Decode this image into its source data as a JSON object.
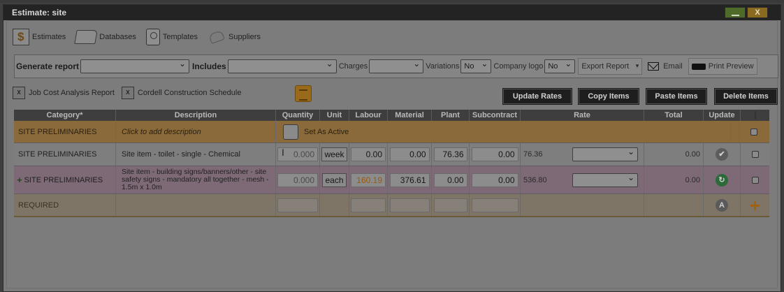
{
  "window": {
    "title": "Estimate: site",
    "close_label": "X"
  },
  "nav": [
    {
      "label": "Estimates",
      "icon": "estimates-icon"
    },
    {
      "label": "Databases",
      "icon": "folder-icon"
    },
    {
      "label": "Templates",
      "icon": "templates-icon"
    },
    {
      "label": "Suppliers",
      "icon": "suppliers-icon"
    }
  ],
  "report_bar": {
    "generate_label": "Generate report",
    "generate_value": "",
    "includes_label": "Includes",
    "includes_value": "",
    "charges_label": "Charges",
    "charges_value": "",
    "variations_label": "Variations",
    "variations_value": "No",
    "company_logo_label": "Company logo",
    "company_logo_value": "No",
    "export_label": "Export Report",
    "email_label": "Email",
    "print_label": "Print Preview"
  },
  "links": {
    "job_cost": "Job Cost Analysis Report",
    "cordell": "Cordell Construction Schedule",
    "xls": "X"
  },
  "actions": {
    "update_rates": "Update Rates",
    "copy_items": "Copy Items",
    "paste_items": "Paste Items",
    "delete_items": "Delete Items"
  },
  "table": {
    "headers": [
      "Category*",
      "Description",
      "Quantity",
      "Unit",
      "Labour",
      "Material",
      "Plant",
      "Subcontract",
      "Rate",
      "Total",
      "Update",
      ""
    ],
    "category_row": {
      "category": "SITE PRELIMINARIES",
      "description_placeholder": "Click to add description",
      "set_active": "Set As Active"
    },
    "items": [
      {
        "category": "SITE PRELIMINARIES",
        "description": "Site item - toilet - single - Chemical",
        "quantity": "0.000",
        "unit": "week",
        "labour": "0.00",
        "material": "0.00",
        "plant": "76.36",
        "subcontract": "0.00",
        "rate": "76.36",
        "total": "0.00",
        "update_icon": "check-icon"
      },
      {
        "category": "SITE PRELIMINARIES",
        "expand_icon": "+",
        "description": "Site item - building signs/banners/other - site safety signs - mandatory all together - mesh - 1.5m x 1.0m",
        "quantity": "0.000",
        "unit": "each",
        "labour": "160.19",
        "material": "376.61",
        "plant": "0.00",
        "subcontract": "0.00",
        "rate": "536.80",
        "total": "0.00",
        "update_icon": "refresh-icon"
      }
    ],
    "required_row": {
      "category": "REQUIRED",
      "update_icon_letter": "A",
      "add_icon": "+"
    }
  },
  "colors": {
    "titlebar": "#232323",
    "header": "#3e3e3e",
    "category_row": "#8a6a3a",
    "pink_row": "#7e6a76",
    "action_button": "#1e1e1e",
    "labour_highlight": "#9a5a10",
    "refresh_green": "#2d6a3a",
    "add_orange": "#a0620f"
  }
}
